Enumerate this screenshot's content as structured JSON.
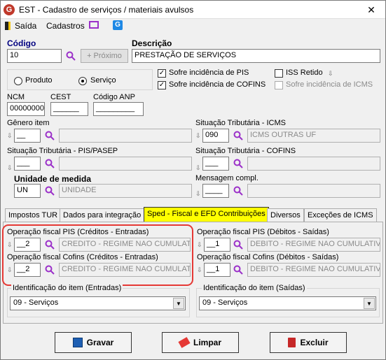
{
  "window": {
    "title": "EST - Cadastro de serviços / materiais avulsos",
    "app_icon": "G",
    "close": "✕"
  },
  "menu": {
    "saida": "Saída",
    "cadastros": "Cadastros"
  },
  "codigo": {
    "label": "Código",
    "value": "10",
    "next_label": "+ Próximo"
  },
  "descricao": {
    "label": "Descrição",
    "value": "PRESTAÇÃO DE SERVIÇOS"
  },
  "tipo": {
    "produto": "Produto",
    "servico": "Serviço",
    "selected": "Serviço"
  },
  "checks": {
    "pis": "Sofre incidência de PIS",
    "cofins": "Sofre incidência de COFINS",
    "iss": "ISS Retido",
    "icms": "Sofre incidência de ICMS"
  },
  "ncm": {
    "label": "NCM",
    "value": "00000000"
  },
  "cest": {
    "label": "CEST",
    "value": "______"
  },
  "anp": {
    "label": "Código ANP",
    "value": "_________"
  },
  "genero": {
    "label": "Gênero item",
    "value": "__"
  },
  "sit_icms": {
    "label": "Situação Tributária - ICMS",
    "code": "090",
    "desc": "ICMS OUTRAS UF"
  },
  "sit_pis": {
    "label": "Situação Tributária - PIS/PASEP",
    "value": "___"
  },
  "sit_cofins": {
    "label": "Situação Tributária - COFINS",
    "value": "___"
  },
  "unidade": {
    "label": "Unidade de medida",
    "code": "UN",
    "desc": "UNIDADE"
  },
  "mensagem": {
    "label": "Mensagem compl.",
    "value": "____"
  },
  "tabs": [
    "Impostos TUR",
    "Dados para integração",
    "Sped - Fiscal e EFD Contribuições",
    "Diversos",
    "Exceções de ICMS"
  ],
  "op_pis_ent": {
    "label": "Operação fiscal PIS (Créditos - Entradas)",
    "code": "__2",
    "desc": "CREDITO - REGIME NAO CUMULATI"
  },
  "op_cof_ent": {
    "label": "Operação fiscal Cofins (Créditos - Entradas)",
    "code": "__2",
    "desc": "CREDITO - REGIME NAO CUMULATI"
  },
  "op_pis_sai": {
    "label": "Operação fiscal PIS (Débitos - Saídas)",
    "code": "__1",
    "desc": "DEBITO - REGIME NAO CUMULATIVO"
  },
  "op_cof_sai": {
    "label": "Operação fiscal Cofins (Débitos - Saídas)",
    "code": "__1",
    "desc": "DEBITO - REGIME NAO CUMULATIVO"
  },
  "ident_ent": {
    "label": "Identificação do item (Entradas)",
    "value": "09 - Serviços"
  },
  "ident_sai": {
    "label": "Identificação do item (Saídas)",
    "value": "09 - Serviços"
  },
  "buttons": {
    "gravar": "Gravar",
    "limpar": "Limpar",
    "excluir": "Excluir"
  },
  "colors": {
    "accent_tab": "#ffff00",
    "highlight": "#e53935",
    "magnifier": "#9b30c9"
  }
}
